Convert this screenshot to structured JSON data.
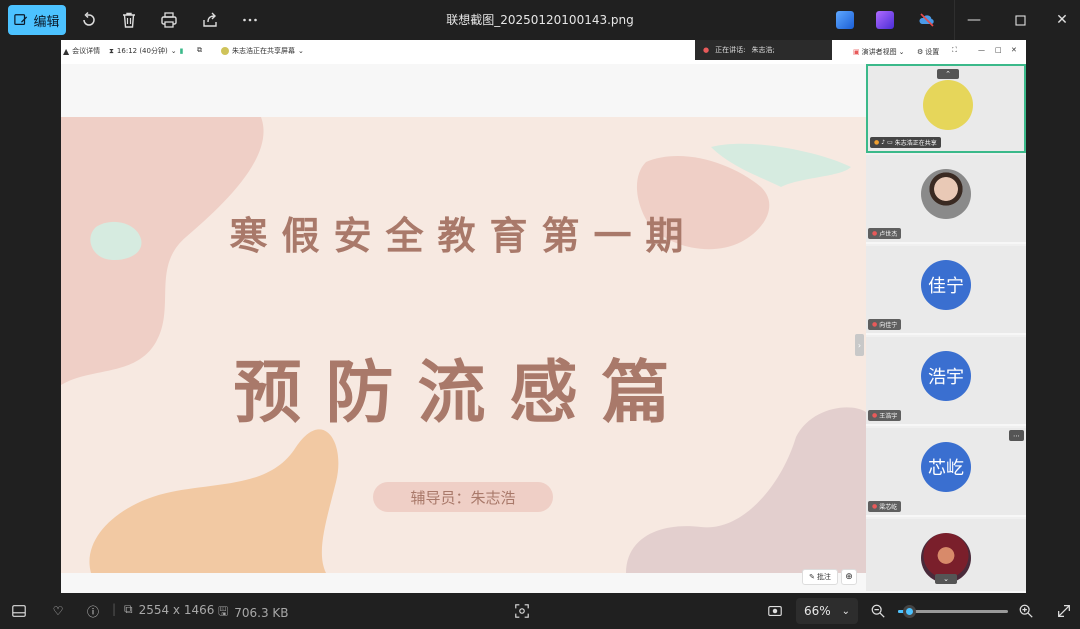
{
  "titlebar": {
    "edit_label": "编辑",
    "file_name": "联想截图_20250120100143.png"
  },
  "meeting": {
    "details_label": "会议详情",
    "time_label": "16:12 (40分钟)",
    "sharing_label": "朱志浩正在共享屏幕",
    "speaking_label": "正在讲话:",
    "speaking_name": "朱志浩;",
    "view_label": "演讲者视图",
    "settings_label": "设置"
  },
  "slide": {
    "title_line1": "寒假安全教育第一期",
    "title_line2": "预防流感篇",
    "tutor": "辅导员：朱志浩"
  },
  "annotate_label": "批注",
  "participants": [
    {
      "name": "朱志浩正在共享",
      "avatar_text": "",
      "style": "yellow",
      "active": true
    },
    {
      "name": "卢世杰",
      "avatar_text": "",
      "style": "photo1",
      "active": false
    },
    {
      "name": "向佳宁",
      "avatar_text": "佳宁",
      "style": "blue",
      "active": false
    },
    {
      "name": "王浩宇",
      "avatar_text": "浩宇",
      "style": "blue",
      "active": false
    },
    {
      "name": "梁芯屹",
      "avatar_text": "芯屹",
      "style": "blue",
      "active": false
    },
    {
      "name": "",
      "avatar_text": "",
      "style": "photo2",
      "active": false
    }
  ],
  "status": {
    "dimensions": "2554 x 1466",
    "file_size": "706.3 KB",
    "zoom": "66%",
    "zoom_fraction": 0.1
  },
  "colors": {
    "accent": "#4cc2ff",
    "slide_text": "#a9796a",
    "active_tile_border": "#3bb98a",
    "avatar_blue": "#3a6fd0"
  }
}
